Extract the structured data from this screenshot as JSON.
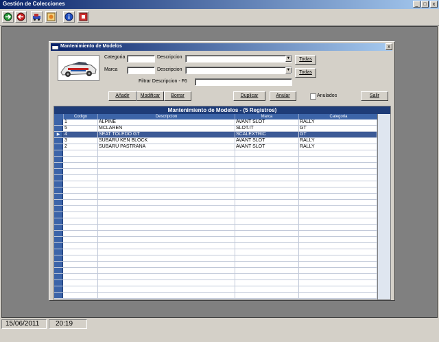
{
  "app": {
    "title": "Gestión de Colecciones",
    "window_buttons": [
      "_",
      "□",
      "x"
    ]
  },
  "toolbar": {
    "buttons": [
      {
        "icon": "green-arrow-icon"
      },
      {
        "icon": "red-arrow-icon"
      },
      {
        "icon": "car-icon"
      },
      {
        "icon": "image-icon"
      },
      {
        "icon": "info-icon"
      },
      {
        "icon": "exit-icon"
      }
    ]
  },
  "dialog": {
    "title": "Mantenimiento de Modelos",
    "close": "x",
    "labels": {
      "categoria": "Categoria",
      "marca": "Marca",
      "descripcion1": "Descripcion",
      "descripcion2": "Descripcion",
      "filtrar": "Filtrar Descripcion - F6",
      "anulados": "Anulados"
    },
    "buttons": {
      "todas1": "Todas",
      "todas2": "Todas",
      "anadir": "Añadir",
      "modificar": "Modificar",
      "borrar": "Borrar",
      "duplicar": "Duplicar",
      "anular": "Anular",
      "salir": "Salir"
    }
  },
  "grid": {
    "caption": "Mantenimiento de Modelos - (5 Registros)",
    "columns": [
      "Codigo",
      "Descripcion",
      "Marca",
      "Categoria"
    ],
    "rows": [
      {
        "codigo": "1",
        "descripcion": "ALPINE",
        "marca": "AVANT SLOT",
        "categoria": "RALLY"
      },
      {
        "codigo": "5",
        "descripcion": "MCLAREN",
        "marca": "SLOT.IT",
        "categoria": "GT"
      },
      {
        "codigo": "4",
        "descripcion": "SEAT TOLEDO GT",
        "marca": "SCALEXTRIC",
        "categoria": "GT"
      },
      {
        "codigo": "3",
        "descripcion": "SUBARU KEN BLOCK",
        "marca": "AVANT SLOT",
        "categoria": "RALLY"
      },
      {
        "codigo": "2",
        "descripcion": "SUBARU PASTRANA",
        "marca": "AVANT SLOT",
        "categoria": "RALLY"
      }
    ],
    "current_row_marker": "▶"
  },
  "status": {
    "date": "15/06/2011",
    "time": "20:19"
  }
}
